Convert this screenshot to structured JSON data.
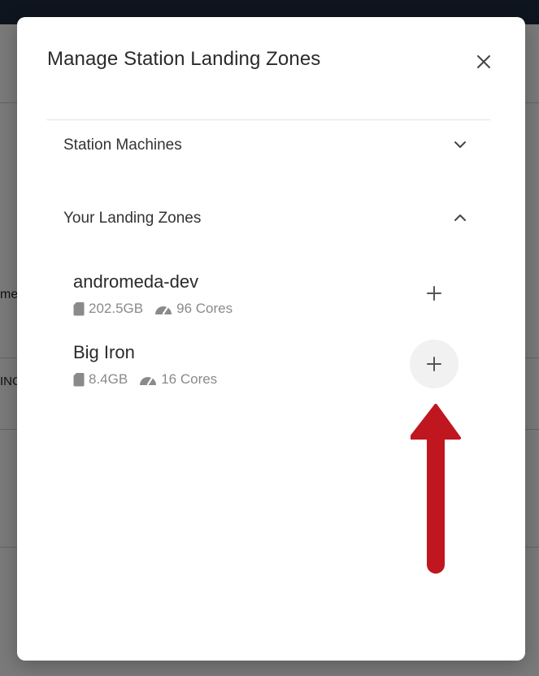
{
  "background": {
    "partial_text_1": "me",
    "partial_text_2": "INC"
  },
  "dialog": {
    "title": "Manage Station Landing Zones",
    "close_icon": "close-icon",
    "sections": [
      {
        "label": "Station Machines",
        "expanded": false,
        "chevron": "chevron-down-icon"
      },
      {
        "label": "Your Landing Zones",
        "expanded": true,
        "chevron": "chevron-up-icon"
      }
    ],
    "landing_zones": [
      {
        "name": "andromeda-dev",
        "storage": "202.5GB",
        "cores": "96 Cores",
        "action_icon": "plus-icon"
      },
      {
        "name": "Big Iron",
        "storage": "8.4GB",
        "cores": "16 Cores",
        "action_icon": "plus-icon",
        "highlighted": true
      }
    ]
  },
  "annotation": {
    "type": "arrow",
    "color": "#c0161f",
    "points_to": "Big Iron add button"
  }
}
